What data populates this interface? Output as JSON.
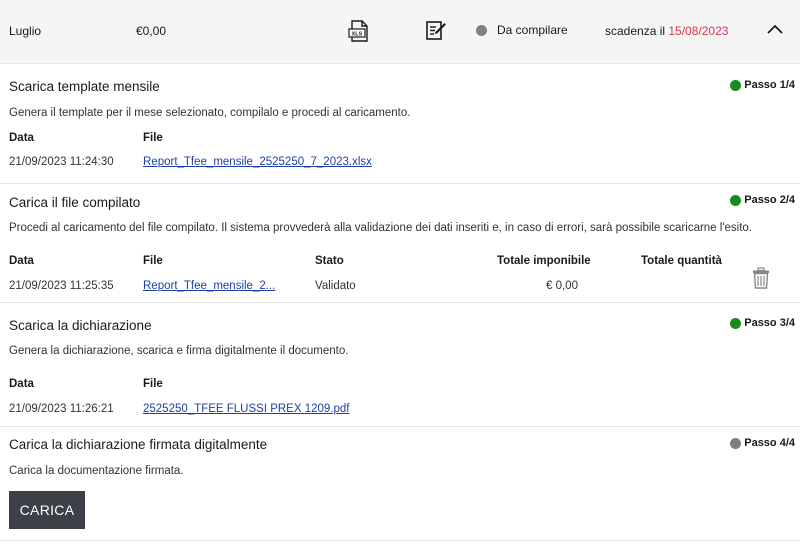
{
  "header": {
    "month": "Luglio",
    "amount": "€0,00",
    "status": "Da compilare",
    "deadline_prefix": "scadenza il ",
    "deadline_date": "15/08/2023"
  },
  "colors": {
    "step_done": "#1a8a1a",
    "step_pending": "#808080",
    "deadline": "#d9364f",
    "link": "#1f3fa6",
    "button_bg": "#3c4147"
  },
  "steps": [
    {
      "title": "Scarica template mensile",
      "step_label": "Passo 1/4",
      "status": "done",
      "description": "Genera il template per il mese selezionato, compilalo e procedi al caricamento.",
      "col_data": "Data",
      "col_file": "File",
      "date": "21/09/2023 11:24:30",
      "file": "Report_Tfee_mensile_2525250_7_2023.xlsx"
    },
    {
      "title": "Carica il file compilato",
      "step_label": "Passo 2/4",
      "status": "done",
      "description": "Procedi al caricamento del file compilato. Il sistema provvederà alla validazione dei dati inseriti e, in caso di errori, sarà possibile scaricarne l'esito.",
      "col_data": "Data",
      "col_file": "File",
      "col_stato": "Stato",
      "col_imponibile": "Totale imponibile",
      "col_quantita": "Totale quantità",
      "date": "21/09/2023 11:25:35",
      "file": "Report_Tfee_mensile_2...",
      "stato": "Validato",
      "imponibile": "€ 0,00"
    },
    {
      "title": "Scarica la dichiarazione",
      "step_label": "Passo 3/4",
      "status": "done",
      "description": "Genera la dichiarazione, scarica e firma digitalmente il documento.",
      "col_data": "Data",
      "col_file": "File",
      "date": "21/09/2023 11:26:21",
      "file": "2525250_TFEE FLUSSI PREX 1209.pdf"
    },
    {
      "title": "Carica la dichiarazione firmata digitalmente",
      "step_label": "Passo 4/4",
      "status": "pending",
      "description": "Carica la documentazione firmata.",
      "button": "CARICA"
    }
  ],
  "icons": {
    "xls": "xls-file-icon",
    "edit": "edit-document-icon",
    "chevron": "chevron-up-icon",
    "trash": "trash-icon"
  }
}
